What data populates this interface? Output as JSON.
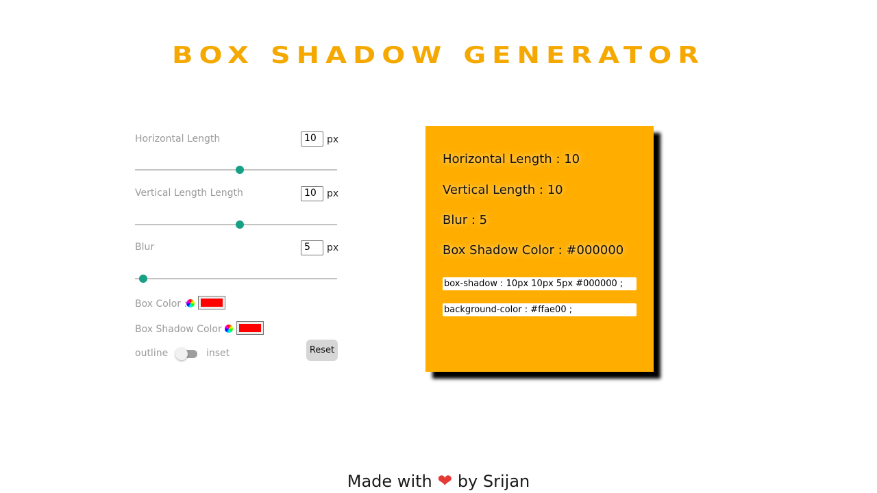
{
  "header": {
    "title": "BOX SHADOW GENERATOR"
  },
  "controls": {
    "horizontal": {
      "label": "Horizontal Length",
      "value": "10",
      "unit": "px",
      "slider_fraction": 0.52
    },
    "vertical": {
      "label": "Vertical Length Length",
      "value": "10",
      "unit": "px",
      "slider_fraction": 0.52
    },
    "blur": {
      "label": "Blur",
      "value": "5",
      "unit": "px",
      "slider_fraction": 0.04
    },
    "box_color": {
      "label": "Box Color :",
      "value": "#ff0000"
    },
    "box_shadow_color": {
      "label": "Box Shadow Color :",
      "value": "#ff0000"
    },
    "mode": {
      "left_label": "outline",
      "right_label": "inset",
      "inset_on": false
    },
    "reset_label": "Reset"
  },
  "preview": {
    "background": "#ffae00",
    "shadow_color": "#000000",
    "lines": {
      "horizontal": "Horizontal Length : 10",
      "vertical": "Vertical Length : 10",
      "blur": "Blur : 5",
      "shadow_color": "Box Shadow Color : #000000"
    },
    "code": {
      "box_shadow": "box-shadow : 10px 10px 5px #000000 ;",
      "background": "background-color : #ffae00 ;"
    }
  },
  "footer": {
    "prefix": "Made with",
    "heart": "❤",
    "suffix": "by Srijan"
  }
}
